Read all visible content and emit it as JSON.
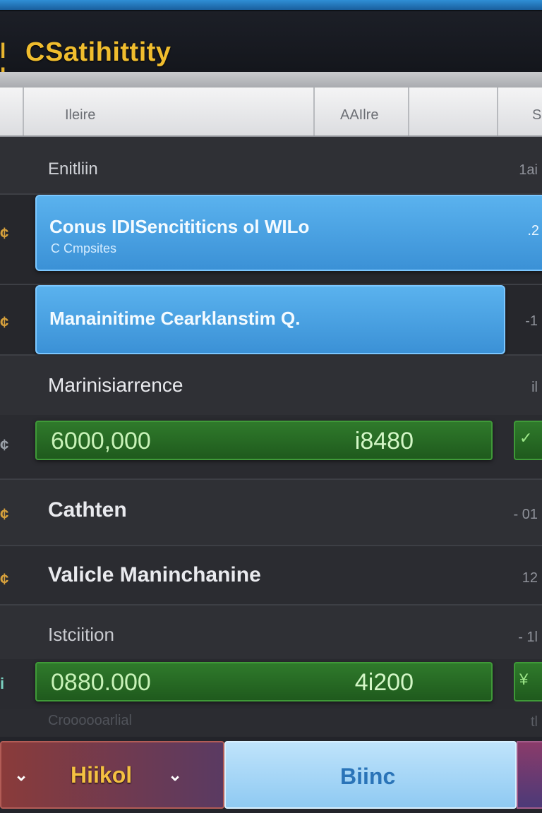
{
  "header": {
    "brand_mark": "l I",
    "title": "CSatihittity"
  },
  "columns": {
    "col1": "Ileire",
    "col2": "AAIlre",
    "col3": "S"
  },
  "rows": [
    {
      "label": "Enitliin",
      "right": "1ai"
    },
    {
      "label": "Conus IDISencititicns ol WILo",
      "sublabel": "C Cmpsites",
      "right": ".2",
      "icon": "¢"
    },
    {
      "label": "Manainitime Cearklanstim Q.",
      "right": "-1",
      "icon": "¢"
    },
    {
      "label": "Marinisiarrence",
      "right": "il"
    },
    {
      "value1": "6000,000",
      "value2": "i8480",
      "side": "✓",
      "icon": "¢"
    },
    {
      "label": "Cathten",
      "right": "- 01",
      "icon": "¢"
    },
    {
      "label": "Valicle Maninchanine",
      "right": "12",
      "icon": "¢"
    },
    {
      "label": "Istciition",
      "right": "- 1l"
    },
    {
      "value1": "0880.000",
      "value2": "4i200",
      "side": "¥",
      "icon": "i"
    },
    {
      "label": "Croooooarlial",
      "right": "tl"
    }
  ],
  "footer": {
    "left_button": "Hiikol",
    "mid_button": "Biinc"
  },
  "colors": {
    "accent_gold": "#f0bd2e",
    "accent_blue": "#3b91d6",
    "accent_green": "#2f7a2b"
  }
}
